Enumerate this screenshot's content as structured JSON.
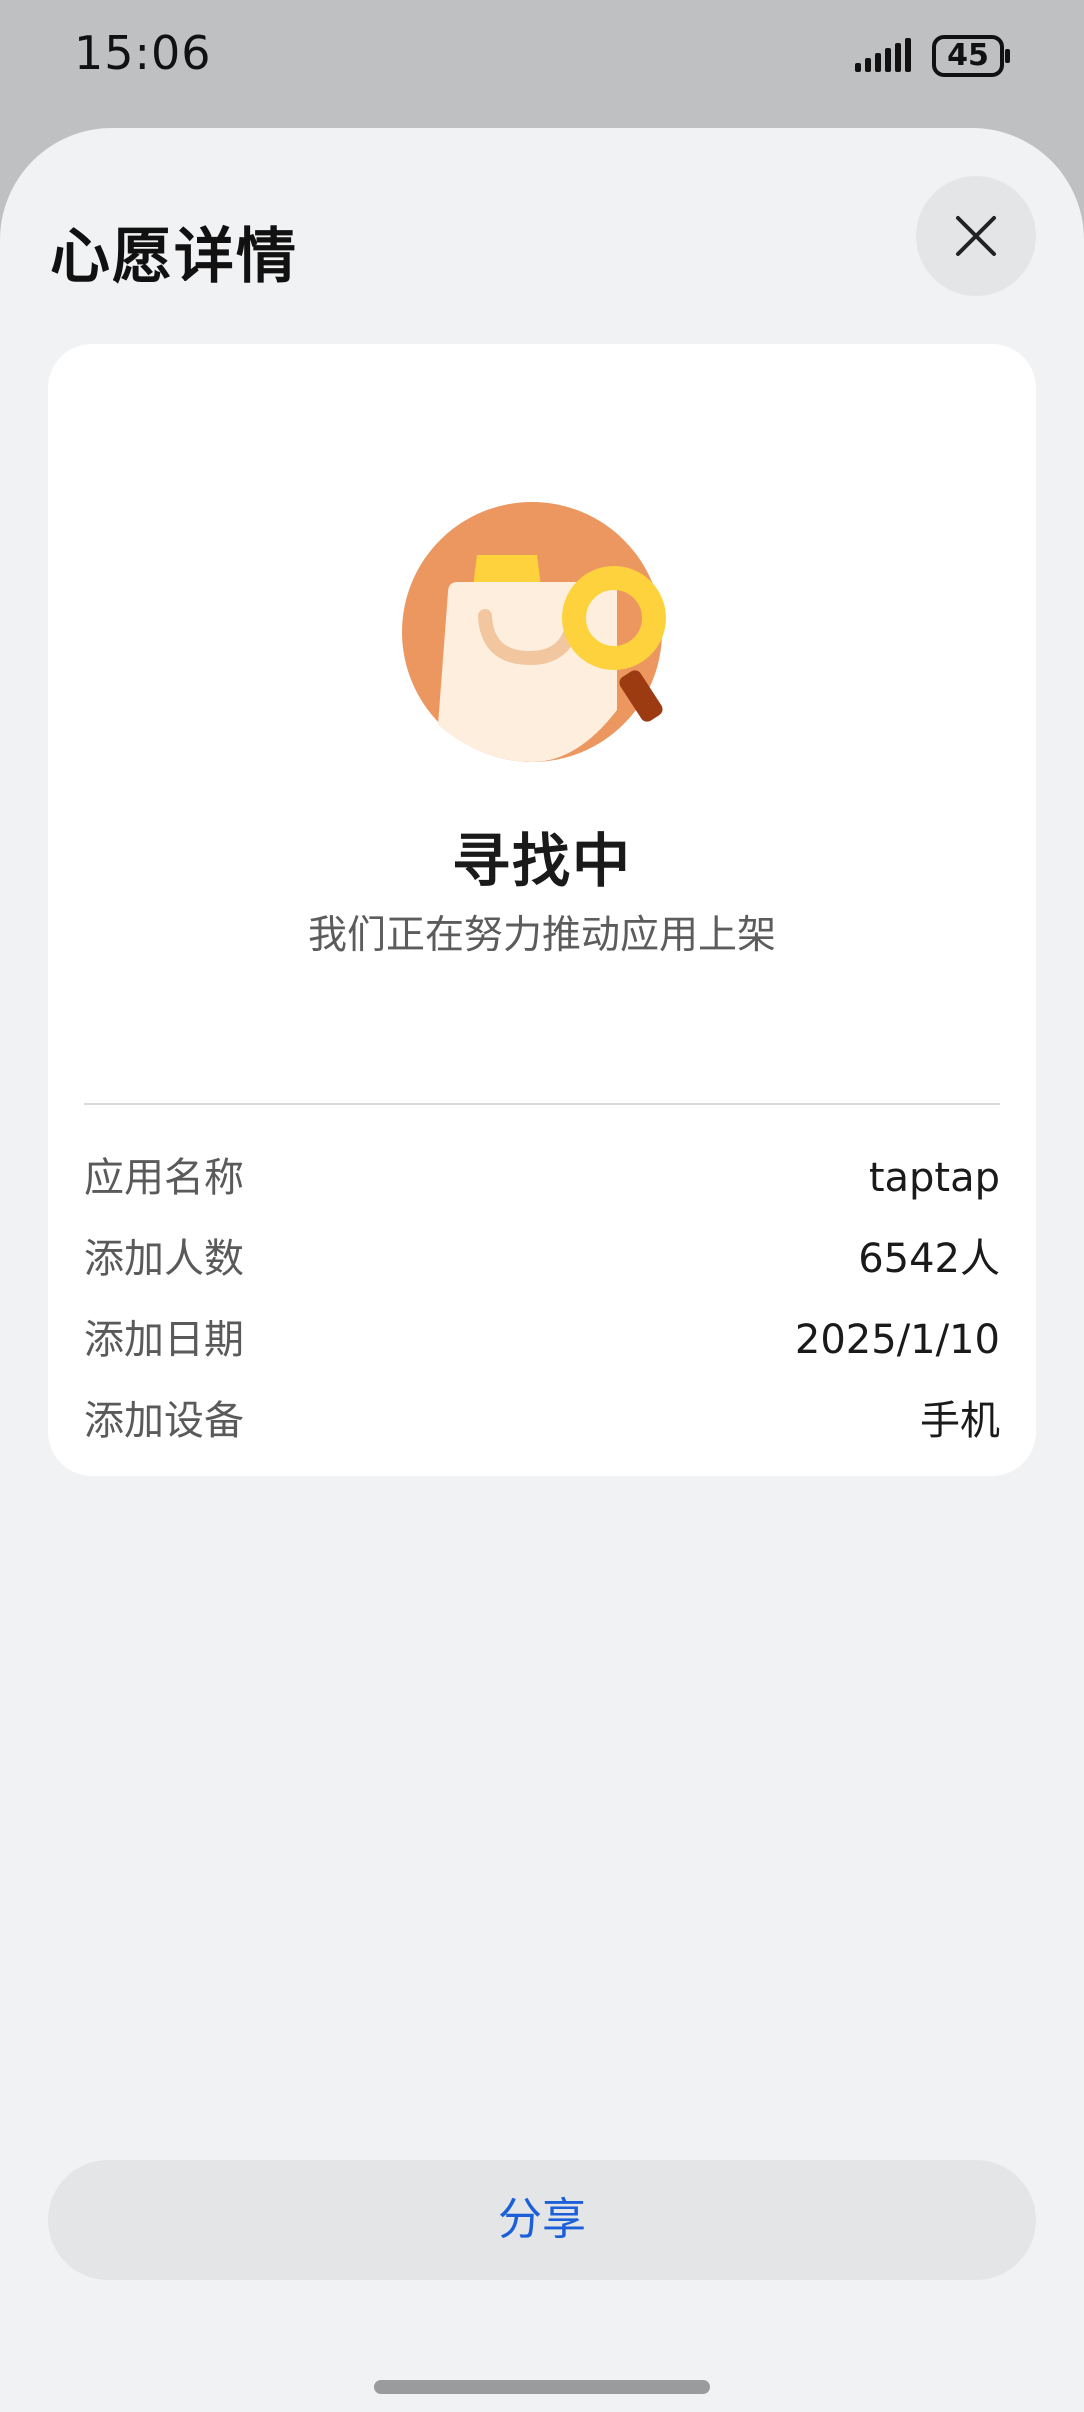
{
  "status_bar": {
    "time": "15:06",
    "battery": "45",
    "icons": [
      "signal-icon",
      "battery-icon"
    ]
  },
  "sheet": {
    "title": "心愿详情",
    "close_icon": "close-icon"
  },
  "card": {
    "illustration": "shopping-bag-search-icon",
    "status_title": "寻找中",
    "status_subtitle": "我们正在努力推动应用上架",
    "rows": [
      {
        "label": "应用名称",
        "value": "taptap"
      },
      {
        "label": "添加人数",
        "value": "6542人"
      },
      {
        "label": "添加日期",
        "value": "2025/1/10"
      },
      {
        "label": "添加设备",
        "value": "手机"
      }
    ]
  },
  "share_button": {
    "label": "分享"
  },
  "colors": {
    "accent": "#1b60d8",
    "sheet_background": "#f1f2f4",
    "card_background": "#ffffff",
    "illustration_orange": "#ec9760",
    "illustration_yellow": "#fdd23c"
  }
}
